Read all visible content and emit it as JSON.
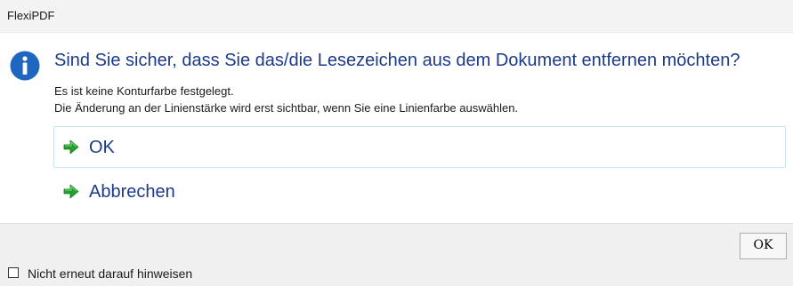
{
  "window": {
    "title": "FlexiPDF"
  },
  "dialog": {
    "icon": "info-icon",
    "main_instruction": "Sind Sie sicher, dass Sie das/die Lesezeichen aus dem Dokument entfernen möchten?",
    "content_lines": [
      "Es ist keine Konturfarbe festgelegt.",
      "Die Änderung an der Linienstärke wird erst sichtbar, wenn Sie eine Linienfarbe auswählen."
    ],
    "command_links": [
      {
        "label": "OK",
        "icon": "green-arrow-icon",
        "focused": true
      },
      {
        "label": "Abbrechen",
        "icon": "green-arrow-icon",
        "focused": false
      }
    ]
  },
  "footer": {
    "ok_button": "OK",
    "checkbox_label": "Nicht erneut darauf hinweisen",
    "checkbox_checked": false
  },
  "colors": {
    "instruction_blue": "#1c3a8c",
    "info_icon_blue": "#1f66c1",
    "arrow_green": "#21a12b",
    "focus_border": "#c6e5f3"
  }
}
